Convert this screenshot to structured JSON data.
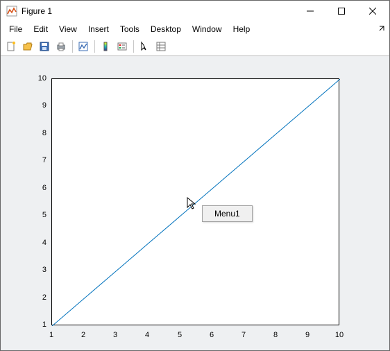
{
  "window": {
    "title": "Figure 1"
  },
  "menubar": {
    "items": [
      "File",
      "Edit",
      "View",
      "Insert",
      "Tools",
      "Desktop",
      "Window",
      "Help"
    ]
  },
  "context_menu": {
    "items": [
      "Menu1"
    ]
  },
  "chart_data": {
    "type": "line",
    "x": [
      1,
      2,
      3,
      4,
      5,
      6,
      7,
      8,
      9,
      10
    ],
    "y": [
      1,
      2,
      3,
      4,
      5,
      6,
      7,
      8,
      9,
      10
    ],
    "xlim": [
      1,
      10
    ],
    "ylim": [
      1,
      10
    ],
    "xticks": [
      1,
      2,
      3,
      4,
      5,
      6,
      7,
      8,
      9,
      10
    ],
    "yticks": [
      1,
      2,
      3,
      4,
      5,
      6,
      7,
      8,
      9,
      10
    ],
    "title": "",
    "xlabel": "",
    "ylabel": "",
    "line_color": "#0072BD"
  }
}
